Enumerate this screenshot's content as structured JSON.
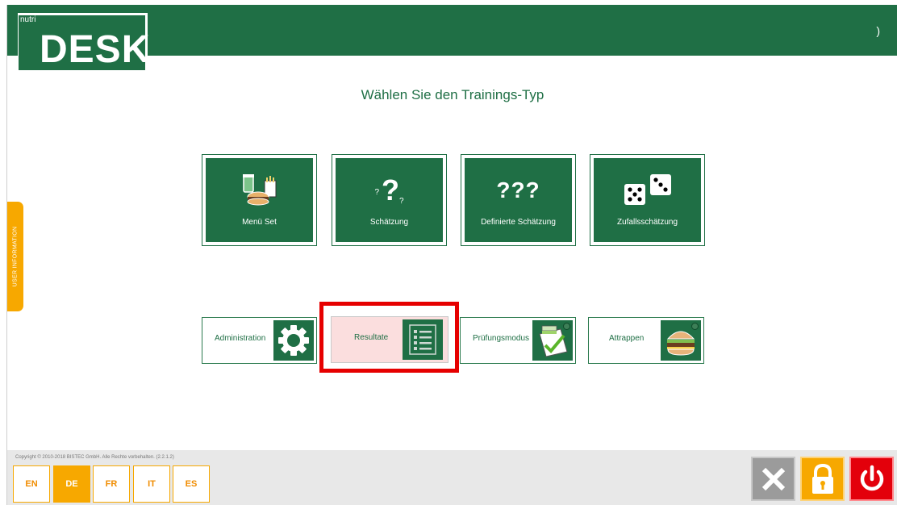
{
  "header": {
    "right_glyph": ")"
  },
  "logo": {
    "small_text": "nutri",
    "big_text": "DESK"
  },
  "title": "Wählen Sie den Trainings-Typ",
  "training_types": [
    {
      "label": "Menü Set",
      "icon": "food-icon"
    },
    {
      "label": "Schätzung",
      "icon": "question-icon"
    },
    {
      "label": "Definierte Schätzung",
      "icon": "triple-question-icon"
    },
    {
      "label": "Zufallsschätzung",
      "icon": "dice-icon"
    }
  ],
  "function_buttons": [
    {
      "label": "Administration",
      "icon": "gear-icon"
    },
    {
      "label": "Resultate",
      "icon": "list-icon",
      "selected": true
    },
    {
      "label": "Prüfungsmodus",
      "icon": "checklist-icon"
    },
    {
      "label": "Attrappen",
      "icon": "burger-icon"
    }
  ],
  "question_marks": {
    "single": "?",
    "small": "?",
    "triple": "???"
  },
  "side_tab": {
    "label": "USER INFORMATION"
  },
  "footer": {
    "copyright": "Copyright © 2010-2018 BISTEC GmbH. Alle Rechte vorbehalten. (2.2.1.2)",
    "languages": [
      "EN",
      "DE",
      "FR",
      "IT",
      "ES"
    ],
    "active_language": "DE"
  },
  "colors": {
    "brand_green": "#1f6f45",
    "accent_orange": "#f7a800",
    "power_red": "#e3000b",
    "highlight_red": "#e60000"
  }
}
